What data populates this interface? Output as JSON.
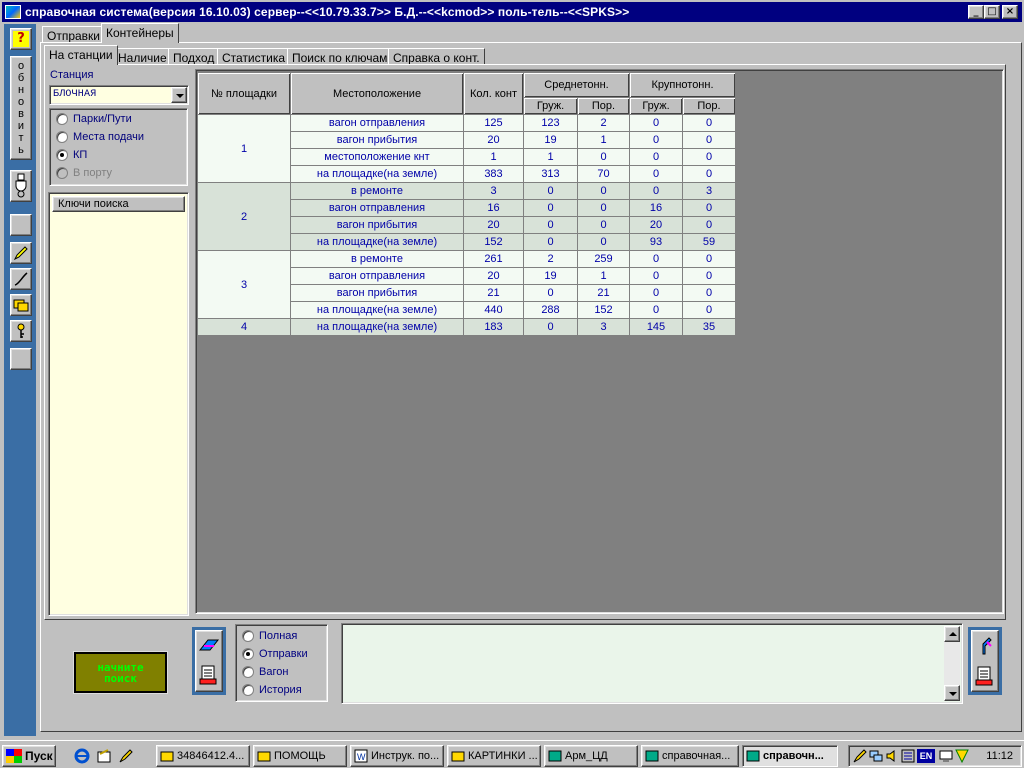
{
  "window": {
    "title": "справочная система(версия 16.10.03) сервер--<<10.79.33.7>> Б.Д.--<<kcmod>> поль-тель--<<SPKS>>",
    "controls": [
      "_",
      "□",
      "×"
    ]
  },
  "left_toolbar": {
    "help_label": "?",
    "refresh_letters": [
      "о",
      "б",
      "н",
      "о",
      "в",
      "и",
      "т",
      "ь"
    ]
  },
  "top_tabs": [
    "Отправки",
    "Контейнеры"
  ],
  "sub_tabs": [
    "На станции",
    "Наличие",
    "Подход",
    "Статистика",
    "Поиск по ключам",
    "Справка о конт."
  ],
  "station": {
    "label": "Станция",
    "value": "БЛОЧНАЯ"
  },
  "location_options": [
    {
      "label": "Парки/Пути",
      "checked": false,
      "disabled": false
    },
    {
      "label": "Места подачи",
      "checked": false,
      "disabled": false
    },
    {
      "label": "КП",
      "checked": true,
      "disabled": false
    },
    {
      "label": "В порту",
      "checked": false,
      "disabled": true
    }
  ],
  "keys": {
    "header": "Ключи поиска"
  },
  "table": {
    "headers": {
      "site": "№ площадки",
      "location": "Местоположение",
      "count": "Кол. конт",
      "medium": "Среднетонн.",
      "large": "Крупнотонн.",
      "loaded": "Груж.",
      "empty": "Пор."
    },
    "groups": [
      {
        "site": "1",
        "rows": [
          [
            "вагон отправления",
            "125",
            "123",
            "2",
            "0",
            "0"
          ],
          [
            "вагон прибытия",
            "20",
            "19",
            "1",
            "0",
            "0"
          ],
          [
            "местоположение кнт",
            "1",
            "1",
            "0",
            "0",
            "0"
          ],
          [
            "на площадке(на земле)",
            "383",
            "313",
            "70",
            "0",
            "0"
          ]
        ]
      },
      {
        "site": "2",
        "rows": [
          [
            "в ремонте",
            "3",
            "0",
            "0",
            "0",
            "3"
          ],
          [
            "вагон отправления",
            "16",
            "0",
            "0",
            "16",
            "0"
          ],
          [
            "вагон прибытия",
            "20",
            "0",
            "0",
            "20",
            "0"
          ],
          [
            "на площадке(на земле)",
            "152",
            "0",
            "0",
            "93",
            "59"
          ]
        ]
      },
      {
        "site": "3",
        "rows": [
          [
            "в ремонте",
            "261",
            "2",
            "259",
            "0",
            "0"
          ],
          [
            "вагон отправления",
            "20",
            "19",
            "1",
            "0",
            "0"
          ],
          [
            "вагон прибытия",
            "21",
            "0",
            "21",
            "0",
            "0"
          ],
          [
            "на площадке(на земле)",
            "440",
            "288",
            "152",
            "0",
            "0"
          ]
        ]
      },
      {
        "site": "4",
        "rows": [
          [
            "на площадке(на земле)",
            "183",
            "0",
            "3",
            "145",
            "35"
          ]
        ]
      }
    ]
  },
  "search_button": {
    "line1": "начните",
    "line2": "поиск"
  },
  "mode_options": [
    {
      "label": "Полная",
      "checked": false
    },
    {
      "label": "Отправки",
      "checked": true
    },
    {
      "label": "Вагон",
      "checked": false
    },
    {
      "label": "История",
      "checked": false
    }
  ],
  "taskbar": {
    "start_label": "Пуск",
    "tasks": [
      {
        "label": "34846412.4...",
        "icon": "folder-icon",
        "active": false
      },
      {
        "label": "ПОМОЩЬ",
        "icon": "folder-icon",
        "active": false
      },
      {
        "label": "Инструк. по...",
        "icon": "word-icon",
        "active": false
      },
      {
        "label": "КАРТИНКИ ...",
        "icon": "folder-icon",
        "active": false
      },
      {
        "label": "Арм_ЦД",
        "icon": "app-icon",
        "active": false
      },
      {
        "label": "справочная...",
        "icon": "app-icon",
        "active": false
      },
      {
        "label": "справочн...",
        "icon": "app-icon",
        "active": true
      }
    ],
    "tray_lang": "EN",
    "clock": "11:12"
  },
  "colors": {
    "title_bar": "#000080",
    "toolbar_blue": "#3a6ea5",
    "table_bg": "#808080",
    "table_text": "#0000a8",
    "keys_bg": "#ffffe1",
    "search_button_bg": "#808000",
    "search_button_text": "#00ff00"
  }
}
